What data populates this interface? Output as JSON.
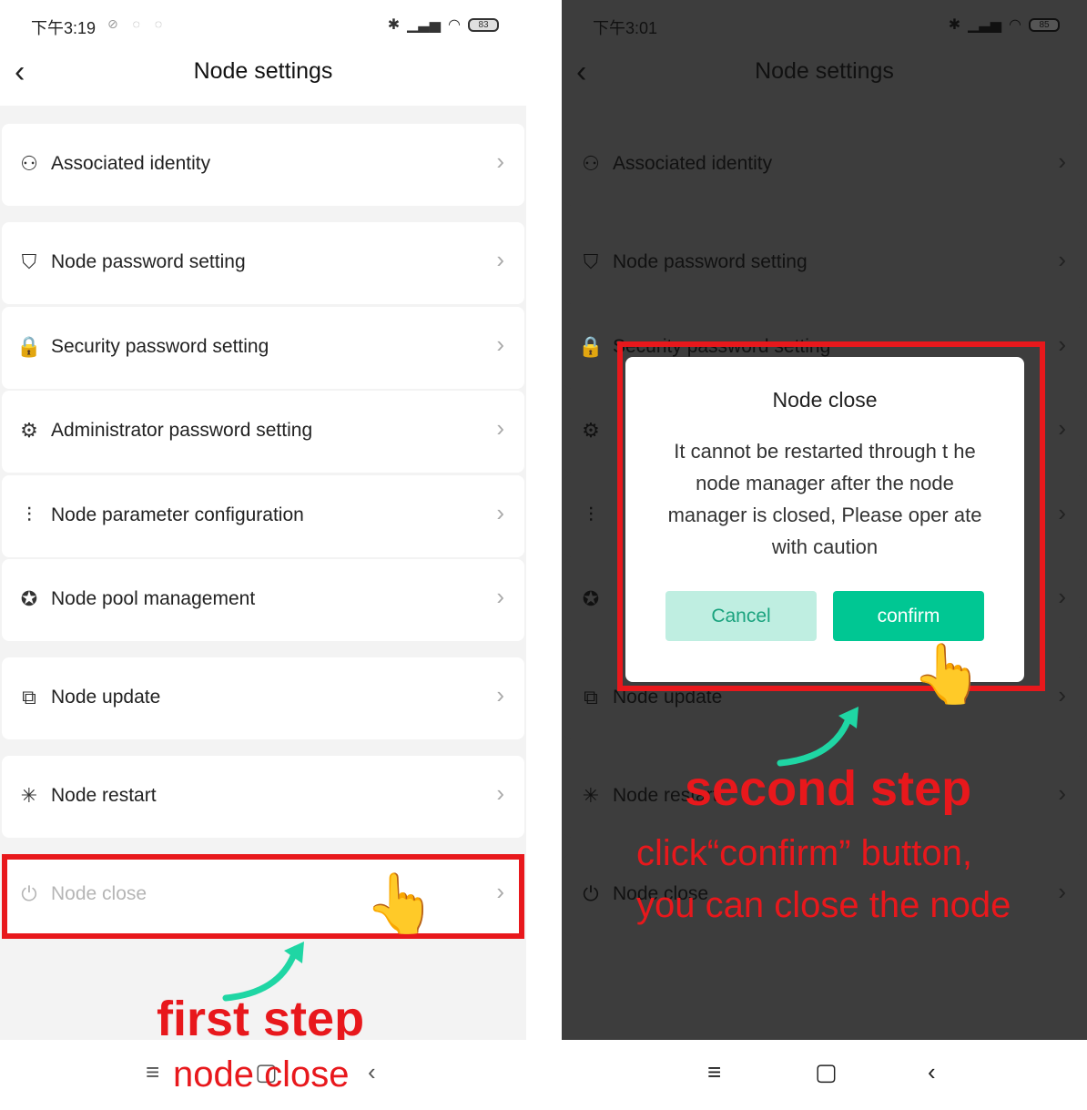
{
  "left_screen": {
    "status": {
      "time": "下午3:19",
      "battery": "83"
    },
    "header": {
      "back_icon": "chevron-left-icon",
      "title": "Node settings"
    },
    "items": [
      {
        "label": "Associated identity",
        "icon": "user-badge-icon",
        "glyph": "⚇"
      },
      {
        "label": "Node password setting",
        "icon": "shield-icon",
        "glyph": "⛉"
      },
      {
        "label": "Security password setting",
        "icon": "lock-icon",
        "glyph": "🔒"
      },
      {
        "label": "Administrator password setting",
        "icon": "user-gear-icon",
        "glyph": "⚙"
      },
      {
        "label": "Node parameter configuration",
        "icon": "sliders-icon",
        "glyph": "⫶"
      },
      {
        "label": "Node pool management",
        "icon": "award-icon",
        "glyph": "✪"
      },
      {
        "label": "Node update",
        "icon": "update-icon",
        "glyph": "⧉"
      },
      {
        "label": "Node restart",
        "icon": "spinner-icon",
        "glyph": "✳"
      },
      {
        "label": "Node close",
        "icon": "power-icon",
        "glyph": "⏻"
      }
    ],
    "annotation": {
      "step": "first step",
      "caption": "node close"
    }
  },
  "right_screen": {
    "status": {
      "time": "下午3:01",
      "battery": "85"
    },
    "header": {
      "title": "Node settings"
    },
    "dialog": {
      "title": "Node close",
      "message": "It cannot be restarted through t he node manager after the node manager is closed, Please oper ate with caution",
      "cancel_label": "Cancel",
      "confirm_label": "confirm"
    },
    "annotation": {
      "step": "second step",
      "line1": "click“confirm” button,",
      "line2": "you can close the node"
    }
  },
  "colors": {
    "accent": "#00c793",
    "highlight": "#e8181c",
    "arrow": "#1fd6a4"
  }
}
